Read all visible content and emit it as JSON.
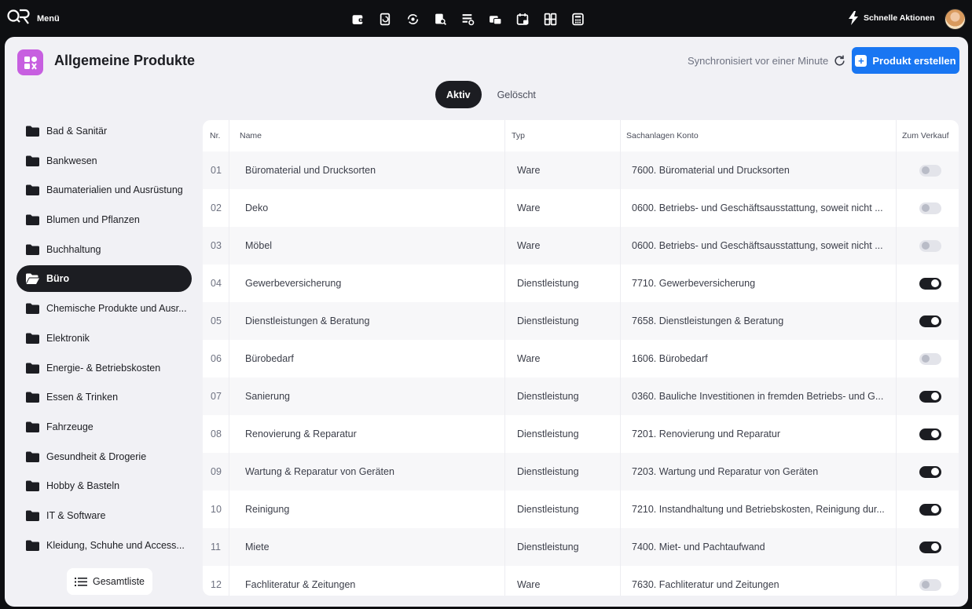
{
  "topbar": {
    "menu_label": "Menü",
    "quick_actions_label": "Schnelle Aktionen",
    "apps": [
      "wallet-icon",
      "receipt-refresh-icon",
      "refresh-money-icon",
      "document-search-icon",
      "list-settings-icon",
      "cards-icon",
      "calendar-lock-icon",
      "grid-icon",
      "calculator-icon"
    ]
  },
  "header": {
    "title": "Allgemeine Produkte",
    "sync_text": "Synchronisiert vor einer Minute",
    "create_label": "Produkt erstellen"
  },
  "tabs": [
    {
      "label": "Aktiv",
      "active": true
    },
    {
      "label": "Gelöscht",
      "active": false
    }
  ],
  "sidebar": {
    "items": [
      {
        "label": "Bad & Sanitär",
        "active": false
      },
      {
        "label": "Bankwesen",
        "active": false
      },
      {
        "label": "Baumaterialien und Ausrüstung",
        "active": false
      },
      {
        "label": "Blumen und Pflanzen",
        "active": false
      },
      {
        "label": "Buchhaltung",
        "active": false
      },
      {
        "label": "Büro",
        "active": true
      },
      {
        "label": "Chemische Produkte und Ausr...",
        "active": false
      },
      {
        "label": "Elektronik",
        "active": false
      },
      {
        "label": "Energie- & Betriebskosten",
        "active": false
      },
      {
        "label": "Essen & Trinken",
        "active": false
      },
      {
        "label": "Fahrzeuge",
        "active": false
      },
      {
        "label": "Gesundheit & Drogerie",
        "active": false
      },
      {
        "label": "Hobby & Basteln",
        "active": false
      },
      {
        "label": "IT & Software",
        "active": false
      },
      {
        "label": "Kleidung, Schuhe und Access...",
        "active": false
      }
    ],
    "all_label": "Gesamtliste"
  },
  "table": {
    "columns": {
      "nr": "Nr.",
      "name": "Name",
      "typ": "Typ",
      "konto": "Sachanlagen Konto",
      "verkauf": "Zum Verkauf"
    },
    "rows": [
      {
        "nr": "01",
        "name": "Büromaterial und Drucksorten",
        "typ": "Ware",
        "konto": "7600. Büromaterial und Drucksorten",
        "verkauf": false
      },
      {
        "nr": "02",
        "name": "Deko",
        "typ": "Ware",
        "konto": "0600. Betriebs- und Geschäftsausstattung, soweit nicht ...",
        "verkauf": false
      },
      {
        "nr": "03",
        "name": "Möbel",
        "typ": "Ware",
        "konto": "0600. Betriebs- und Geschäftsausstattung, soweit nicht ...",
        "verkauf": false
      },
      {
        "nr": "04",
        "name": "Gewerbeversicherung",
        "typ": "Dienstleistung",
        "konto": "7710. Gewerbeversicherung",
        "verkauf": true
      },
      {
        "nr": "05",
        "name": "Dienstleistungen & Beratung",
        "typ": "Dienstleistung",
        "konto": "7658. Dienstleistungen & Beratung",
        "verkauf": true
      },
      {
        "nr": "06",
        "name": "Bürobedarf",
        "typ": "Ware",
        "konto": "1606. Bürobedarf",
        "verkauf": false
      },
      {
        "nr": "07",
        "name": "Sanierung",
        "typ": "Dienstleistung",
        "konto": "0360. Bauliche Investitionen in fremden Betriebs- und G...",
        "verkauf": true
      },
      {
        "nr": "08",
        "name": "Renovierung & Reparatur",
        "typ": "Dienstleistung",
        "konto": "7201. Renovierung und Reparatur",
        "verkauf": true
      },
      {
        "nr": "09",
        "name": "Wartung & Reparatur von Geräten",
        "typ": "Dienstleistung",
        "konto": "7203. Wartung und Reparatur von Geräten",
        "verkauf": true
      },
      {
        "nr": "10",
        "name": "Reinigung",
        "typ": "Dienstleistung",
        "konto": "7210. Instandhaltung und Betriebskosten, Reinigung dur...",
        "verkauf": true
      },
      {
        "nr": "11",
        "name": "Miete",
        "typ": "Dienstleistung",
        "konto": "7400. Miet- und Pachtaufwand",
        "verkauf": true
      },
      {
        "nr": "12",
        "name": "Fachliteratur & Zeitungen",
        "typ": "Ware",
        "konto": "7630. Fachliteratur und Zeitungen",
        "verkauf": false
      }
    ]
  },
  "colors": {
    "accent": "#1976f2",
    "badge": "#c75fe0",
    "dark": "#1c1d22"
  }
}
